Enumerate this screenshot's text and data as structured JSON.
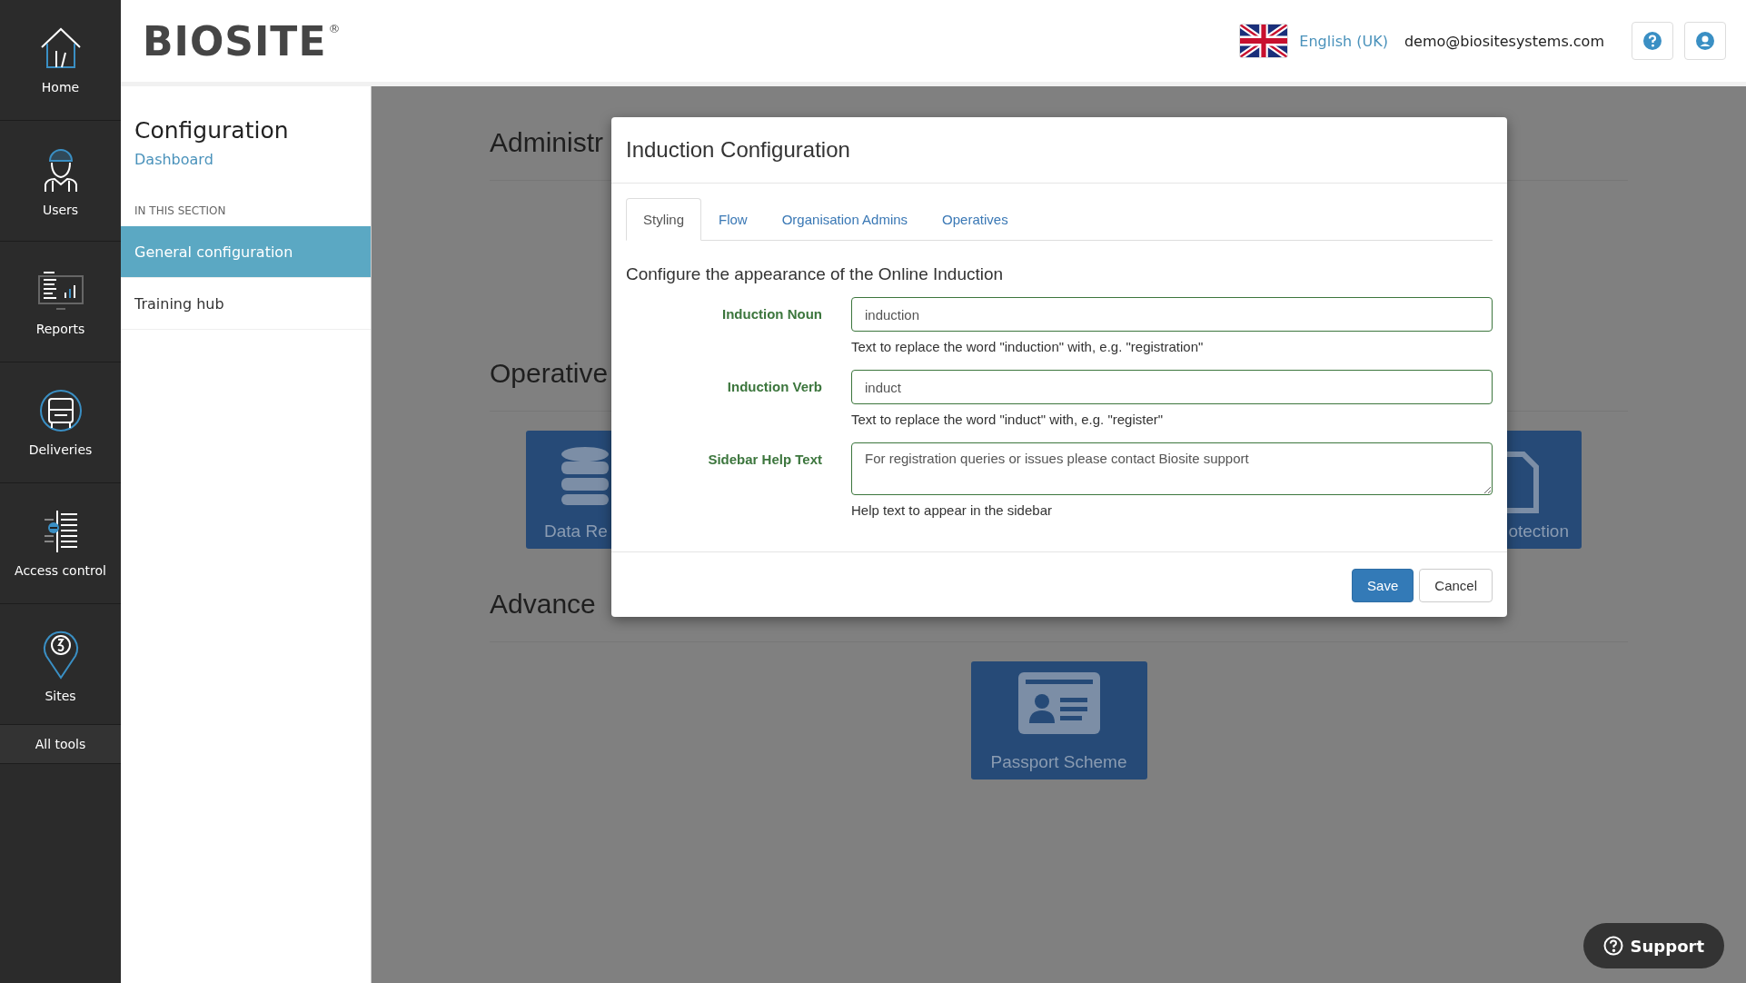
{
  "nav": [
    {
      "label": "Home",
      "kind": "home"
    },
    {
      "label": "Users",
      "kind": "worker"
    },
    {
      "label": "Reports",
      "kind": "report"
    },
    {
      "label": "Deliveries",
      "kind": "truck"
    },
    {
      "label": "Access control",
      "kind": "access"
    },
    {
      "label": "Sites",
      "kind": "pin"
    },
    {
      "label": "All tools",
      "kind": "text"
    }
  ],
  "header": {
    "logo": "BIOSITE",
    "logo_mark": "®",
    "language": "English (UK)",
    "email": "demo@biositesystems.com"
  },
  "section_sidebar": {
    "title": "Configuration",
    "link": "Dashboard",
    "section_label": "IN THIS SECTION",
    "items": [
      {
        "label": "General configuration",
        "selected": true
      },
      {
        "label": "Training hub",
        "selected": false
      }
    ]
  },
  "sections": [
    {
      "heading": "Administr"
    },
    {
      "heading": "Operative",
      "tiles": [
        {
          "label": "Data Re",
          "kind": "database"
        },
        {
          "label": "otection",
          "kind": "document"
        }
      ]
    },
    {
      "heading": "Advance",
      "tiles": [
        {
          "label": "Passport Scheme",
          "kind": "id-card"
        }
      ]
    }
  ],
  "modal": {
    "title": "Induction Configuration",
    "tabs": [
      {
        "label": "Styling",
        "selected": true
      },
      {
        "label": "Flow",
        "selected": false
      },
      {
        "label": "Organisation Admins",
        "selected": false
      },
      {
        "label": "Operatives",
        "selected": false
      }
    ],
    "heading": "Configure the appearance of the Online Induction",
    "fields": [
      {
        "label": "Induction Noun",
        "value": "induction",
        "help": "Text to replace the word \"induction\" with, e.g. \"registration\"",
        "kind": "input"
      },
      {
        "label": "Induction Verb",
        "value": "induct",
        "help": "Text to replace the word \"induct\" with, e.g. \"register\"",
        "kind": "input"
      },
      {
        "label": "Sidebar Help Text",
        "value": "For registration queries or issues please contact Biosite support",
        "help": "Help text to appear in the sidebar",
        "kind": "textarea"
      }
    ],
    "buttons": [
      {
        "label": "Save",
        "kind": "primary"
      },
      {
        "label": "Cancel",
        "kind": "default"
      }
    ]
  },
  "support_button": "Support"
}
